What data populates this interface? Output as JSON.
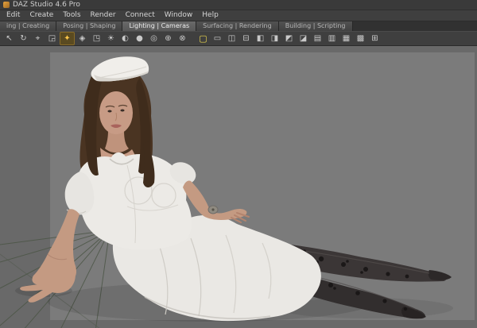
{
  "window": {
    "title": "DAZ Studio 4.6 Pro"
  },
  "menu": {
    "items": [
      "Edit",
      "Create",
      "Tools",
      "Render",
      "Connect",
      "Window",
      "Help"
    ]
  },
  "tabs": [
    {
      "label": "ing | Creating",
      "active": false
    },
    {
      "label": "Posing | Shaping",
      "active": false
    },
    {
      "label": "Lighting | Cameras",
      "active": true
    },
    {
      "label": "Surfacing | Rendering",
      "active": false
    },
    {
      "label": "Building | Scripting",
      "active": false
    }
  ],
  "toolbar": {
    "tools": [
      {
        "name": "node-selection-tool",
        "glyph": "↖"
      },
      {
        "name": "rotate-tool",
        "glyph": "↻"
      },
      {
        "name": "translate-tool",
        "glyph": "⌖"
      },
      {
        "name": "scale-tool",
        "glyph": "◲"
      },
      {
        "name": "active-pose-tool",
        "glyph": "✦"
      },
      {
        "name": "surface-selection-tool",
        "glyph": "◈"
      },
      {
        "name": "orientation-cube",
        "glyph": "◳"
      },
      {
        "name": "create-distant-light",
        "glyph": "☀"
      },
      {
        "name": "create-spot-light",
        "glyph": "◐"
      },
      {
        "name": "create-point-light",
        "glyph": "●"
      },
      {
        "name": "create-camera",
        "glyph": "◎"
      },
      {
        "name": "joint-editor-tool",
        "glyph": "⊕"
      },
      {
        "name": "node-connection-tool",
        "glyph": "⊗"
      }
    ],
    "frame_tool": {
      "name": "aspect-frame-toggle",
      "glyph": "▢"
    },
    "layout_tools": [
      {
        "name": "viewport-layout-single",
        "glyph": "▭"
      },
      {
        "name": "viewport-layout-two-columns",
        "glyph": "◫"
      },
      {
        "name": "viewport-layout-two-rows",
        "glyph": "⊟"
      },
      {
        "name": "viewport-layout-left-split",
        "glyph": "◧"
      },
      {
        "name": "viewport-layout-right-split",
        "glyph": "◨"
      },
      {
        "name": "viewport-layout-top-left",
        "glyph": "◩"
      },
      {
        "name": "viewport-layout-bottom-right",
        "glyph": "◪"
      },
      {
        "name": "viewport-layout-rows",
        "glyph": "▤"
      },
      {
        "name": "viewport-layout-columns",
        "glyph": "▥"
      },
      {
        "name": "viewport-layout-grid",
        "glyph": "▦"
      },
      {
        "name": "viewport-layout-mixed",
        "glyph": "▩"
      },
      {
        "name": "viewport-layout-quad",
        "glyph": "⊞"
      }
    ]
  },
  "colors": {
    "chrome_bg": "#3f3f3f",
    "viewport_bg": "#696969",
    "render_frame_bg": "#7b7b7b",
    "highlight_orange": "#ffc84a",
    "highlight_yellow": "#e8d44d",
    "skin": "#c79b85",
    "hair": "#4a3422",
    "dress": "#eceae6",
    "stockings": "#3b3636",
    "grid_line": "#4a5444"
  }
}
